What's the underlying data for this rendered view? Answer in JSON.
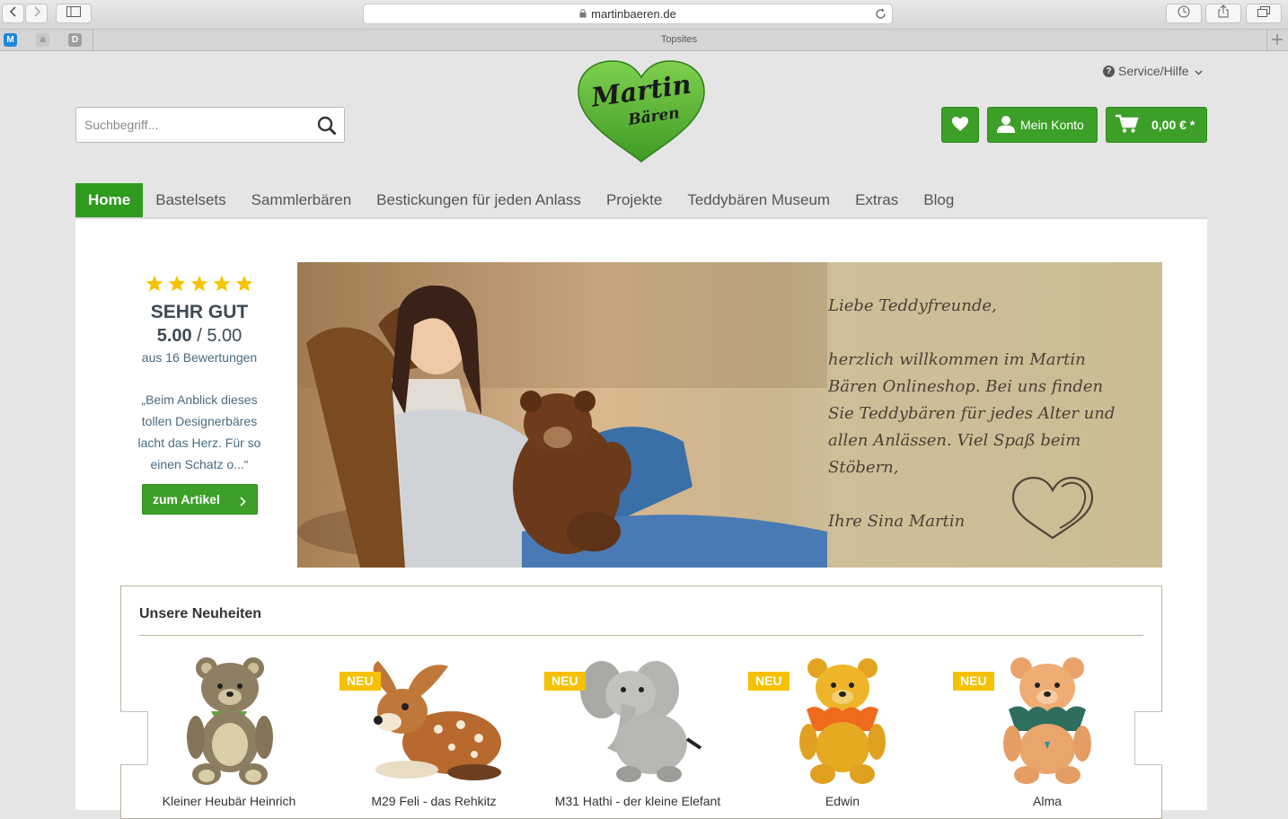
{
  "browser": {
    "url": "martinbaeren.de",
    "topsites_label": "Topsites",
    "favorites": [
      "M",
      "a",
      "D"
    ]
  },
  "header": {
    "logo_text_1": "Martin",
    "logo_text_2": "Bären",
    "service_label": "Service/Hilfe",
    "search_placeholder": "Suchbegriff...",
    "account_label": "Mein Konto",
    "cart_label": "0,00 € *"
  },
  "nav": {
    "items": [
      "Home",
      "Bastelsets",
      "Sammlerbären",
      "Bestickungen für jeden Anlass",
      "Projekte",
      "Teddybären Museum",
      "Extras",
      "Blog"
    ]
  },
  "rating": {
    "stars": 5,
    "label": "SEHR GUT",
    "score": "5.00",
    "max": "/ 5.00",
    "count": "aus 16 Bewertungen",
    "quote": "„Beim Anblick dieses tollen Designerbäres lacht das Herz. Für so einen Schatz o...“",
    "cta": "zum Artikel"
  },
  "banner": {
    "greeting_1": "Liebe Teddyfreunde,",
    "greeting_2": "herzlich willkommen im Martin Bären Onlineshop. Bei uns finden Sie Teddybären für jedes Alter und allen Anlässen. Viel Spaß beim Stöbern,",
    "signature": "Ihre Sina Martin"
  },
  "new_products": {
    "title": "Unsere Neuheiten",
    "badge": "NEU",
    "items": [
      {
        "name": "Kleiner Heubär Heinrich",
        "new": false
      },
      {
        "name": "M29 Feli - das Rehkitz",
        "new": true
      },
      {
        "name": "M31 Hathi - der kleine Elefant",
        "new": true
      },
      {
        "name": "Edwin",
        "new": true
      },
      {
        "name": "Alma",
        "new": true
      }
    ]
  },
  "colors": {
    "brand_green": "#3c9f27",
    "badge_yellow": "#f6c100",
    "star_yellow": "#f5c300"
  }
}
